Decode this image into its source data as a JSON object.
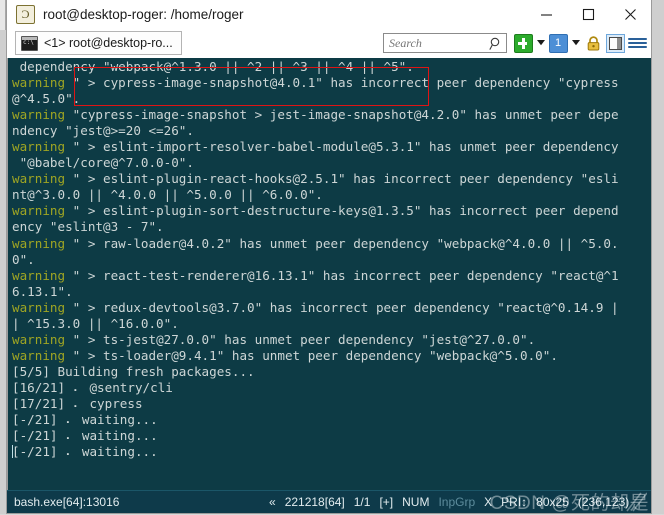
{
  "window": {
    "title": "root@desktop-roger: /home/roger",
    "icon": "conemu-icon",
    "controls": {
      "minimize": "minimize-icon",
      "maximize": "maximize-icon",
      "close": "close-icon"
    }
  },
  "tabbar": {
    "tab": {
      "label": "<1> root@desktop-ro...",
      "icon": "console-icon"
    },
    "search": {
      "value": "",
      "placeholder": "Search",
      "icon": "search-icon"
    },
    "buttons": {
      "new_console": "new-console-icon",
      "new_console_caret": "chevron-down-icon",
      "active_console": "1",
      "active_console_caret": "chevron-down-icon",
      "lock": "lock-icon",
      "panel_toggle": "panel-toggle-icon",
      "menu": "hamburger-menu-icon"
    }
  },
  "terminal": {
    "colors": {
      "background": "#0d3b45",
      "foreground": "#cdd6d6",
      "warning": "#9fa523",
      "annotation": "#e01414"
    },
    "lines": [
      {
        "text": " dependency \"webpack@^1.3.0 || ^2 || ^3 || ^4 || ^5\"."
      },
      {
        "prefix": "warning",
        "text": " \" > cypress-image-snapshot@4.0.1\" has incorrect peer dependency \"cypress"
      },
      {
        "text": "@^4.5.0\"."
      },
      {
        "prefix": "warning",
        "text": " \"cypress-image-snapshot > jest-image-snapshot@4.2.0\" has unmet peer depe"
      },
      {
        "text": "ndency \"jest@>=20 <=26\"."
      },
      {
        "prefix": "warning",
        "text": " \" > eslint-import-resolver-babel-module@5.3.1\" has unmet peer dependency"
      },
      {
        "text": " \"@babel/core@^7.0.0-0\"."
      },
      {
        "prefix": "warning",
        "text": " \" > eslint-plugin-react-hooks@2.5.1\" has incorrect peer dependency \"esli"
      },
      {
        "text": "nt@^3.0.0 || ^4.0.0 || ^5.0.0 || ^6.0.0\"."
      },
      {
        "prefix": "warning",
        "text": " \" > eslint-plugin-sort-destructure-keys@1.3.5\" has incorrect peer depend"
      },
      {
        "text": "ency \"eslint@3 - 7\"."
      },
      {
        "prefix": "warning",
        "text": " \" > raw-loader@4.0.2\" has unmet peer dependency \"webpack@^4.0.0 || ^5.0."
      },
      {
        "text": "0\"."
      },
      {
        "prefix": "warning",
        "text": " \" > react-test-renderer@16.13.1\" has incorrect peer dependency \"react@^1"
      },
      {
        "text": "6.13.1\"."
      },
      {
        "prefix": "warning",
        "text": " \" > redux-devtools@3.7.0\" has incorrect peer dependency \"react@^0.14.9 |"
      },
      {
        "text": "| ^15.3.0 || ^16.0.0\"."
      },
      {
        "prefix": "warning",
        "text": " \" > ts-jest@27.0.0\" has unmet peer dependency \"jest@^27.0.0\"."
      },
      {
        "prefix": "warning",
        "text": " \" > ts-loader@9.4.1\" has unmet peer dependency \"webpack@^5.0.0\"."
      },
      {
        "text": "[5/5] Building fresh packages..."
      },
      {
        "text": "[16/21] ⠄ @sentry/cli"
      },
      {
        "text": "[17/21] ⠄ cypress"
      },
      {
        "text": "[-/21] ⠄ waiting..."
      },
      {
        "text": "[-/21] ⠄ waiting..."
      },
      {
        "text": "[-/21] ⠄ waiting...",
        "cursor": true
      }
    ]
  },
  "statusbar": {
    "left": "bash.exe[64]:13016",
    "scroll_marker": "«",
    "buffer": "221218[64]",
    "page": "1/1",
    "plus": "[+]",
    "num": "NUM",
    "inpgrp": "InpGrp",
    "x": "X",
    "pri": "PRI↕",
    "size": "80x25",
    "coords": "(236,123)"
  },
  "watermark": {
    "text": "CSDN @死的却是"
  }
}
